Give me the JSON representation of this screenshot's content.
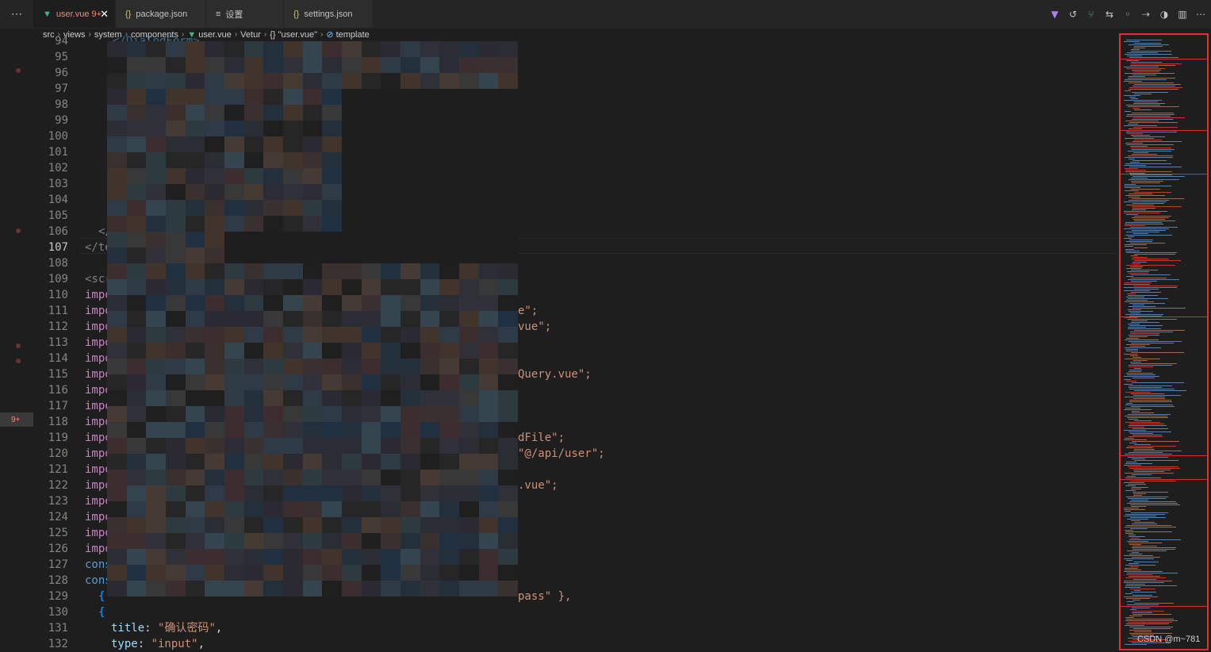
{
  "tabs": [
    {
      "label": "user.vue",
      "badge": "9+",
      "icon": "vue-icon",
      "active": true
    },
    {
      "label": "package.json",
      "icon": "json-icon",
      "active": false
    },
    {
      "label": "设置",
      "icon": "settings-file-icon",
      "active": false
    },
    {
      "label": "settings.json",
      "icon": "json-icon",
      "active": false
    }
  ],
  "toolbar": [
    "vue-devtools-icon",
    "history-icon",
    "source-control-icon",
    "go-back-icon",
    "go-circle-icon",
    "go-forward-icon",
    "open-changes-icon",
    "split-editor-icon",
    "more-actions-icon"
  ],
  "breadcrumb": [
    "src",
    "views",
    "system",
    "components",
    "user.vue",
    "Vetur",
    "{} \"user.vue\"",
    "template"
  ],
  "gutter_badge": "9+",
  "line_numbers": [
    "94",
    "95",
    "96",
    "97",
    "98",
    "99",
    "100",
    "101",
    "102",
    "103",
    "104",
    "105",
    "106",
    "107",
    "108",
    "109",
    "110",
    "111",
    "112",
    "113",
    "114",
    "115",
    "116",
    "117",
    "118",
    "119",
    "120",
    "121",
    "122",
    "123",
    "124",
    "125",
    "126",
    "127",
    "128",
    "129",
    "130",
    "131",
    "132"
  ],
  "current_line": "107",
  "code_lines": {
    "l94": "</DialogForm>",
    "l106": "</",
    "l107": "</te",
    "l109": "<scr",
    "l110": "impo",
    "l111a": "impo",
    "l111b": "e\";",
    "l112a": "impo",
    "l112b": "vue\";",
    "l113": "impo",
    "l114": "impo",
    "l115a": "impo",
    "l115b": "Query.vue\";",
    "l116": "impo",
    "l117": "impo",
    "l118": "impo",
    "l119a": "impo",
    "l119b": "dFile\";",
    "l120a": "impo",
    "l120b": "\"@/api/user\";",
    "l121": "impo",
    "l122a": "impo",
    "l122b": ".vue\";",
    "l123": "impo",
    "l124": "impo",
    "l125": "impo",
    "l126": "impo",
    "l127": "cons",
    "l128": "cons",
    "l129a": "{",
    "l129b": "pass\" },",
    "l130": "{",
    "l131k": "title",
    "l131v": "\"确认密码\"",
    "l132k": "type",
    "l132v": "\"input\""
  },
  "watermark": "CSDN @m~781"
}
